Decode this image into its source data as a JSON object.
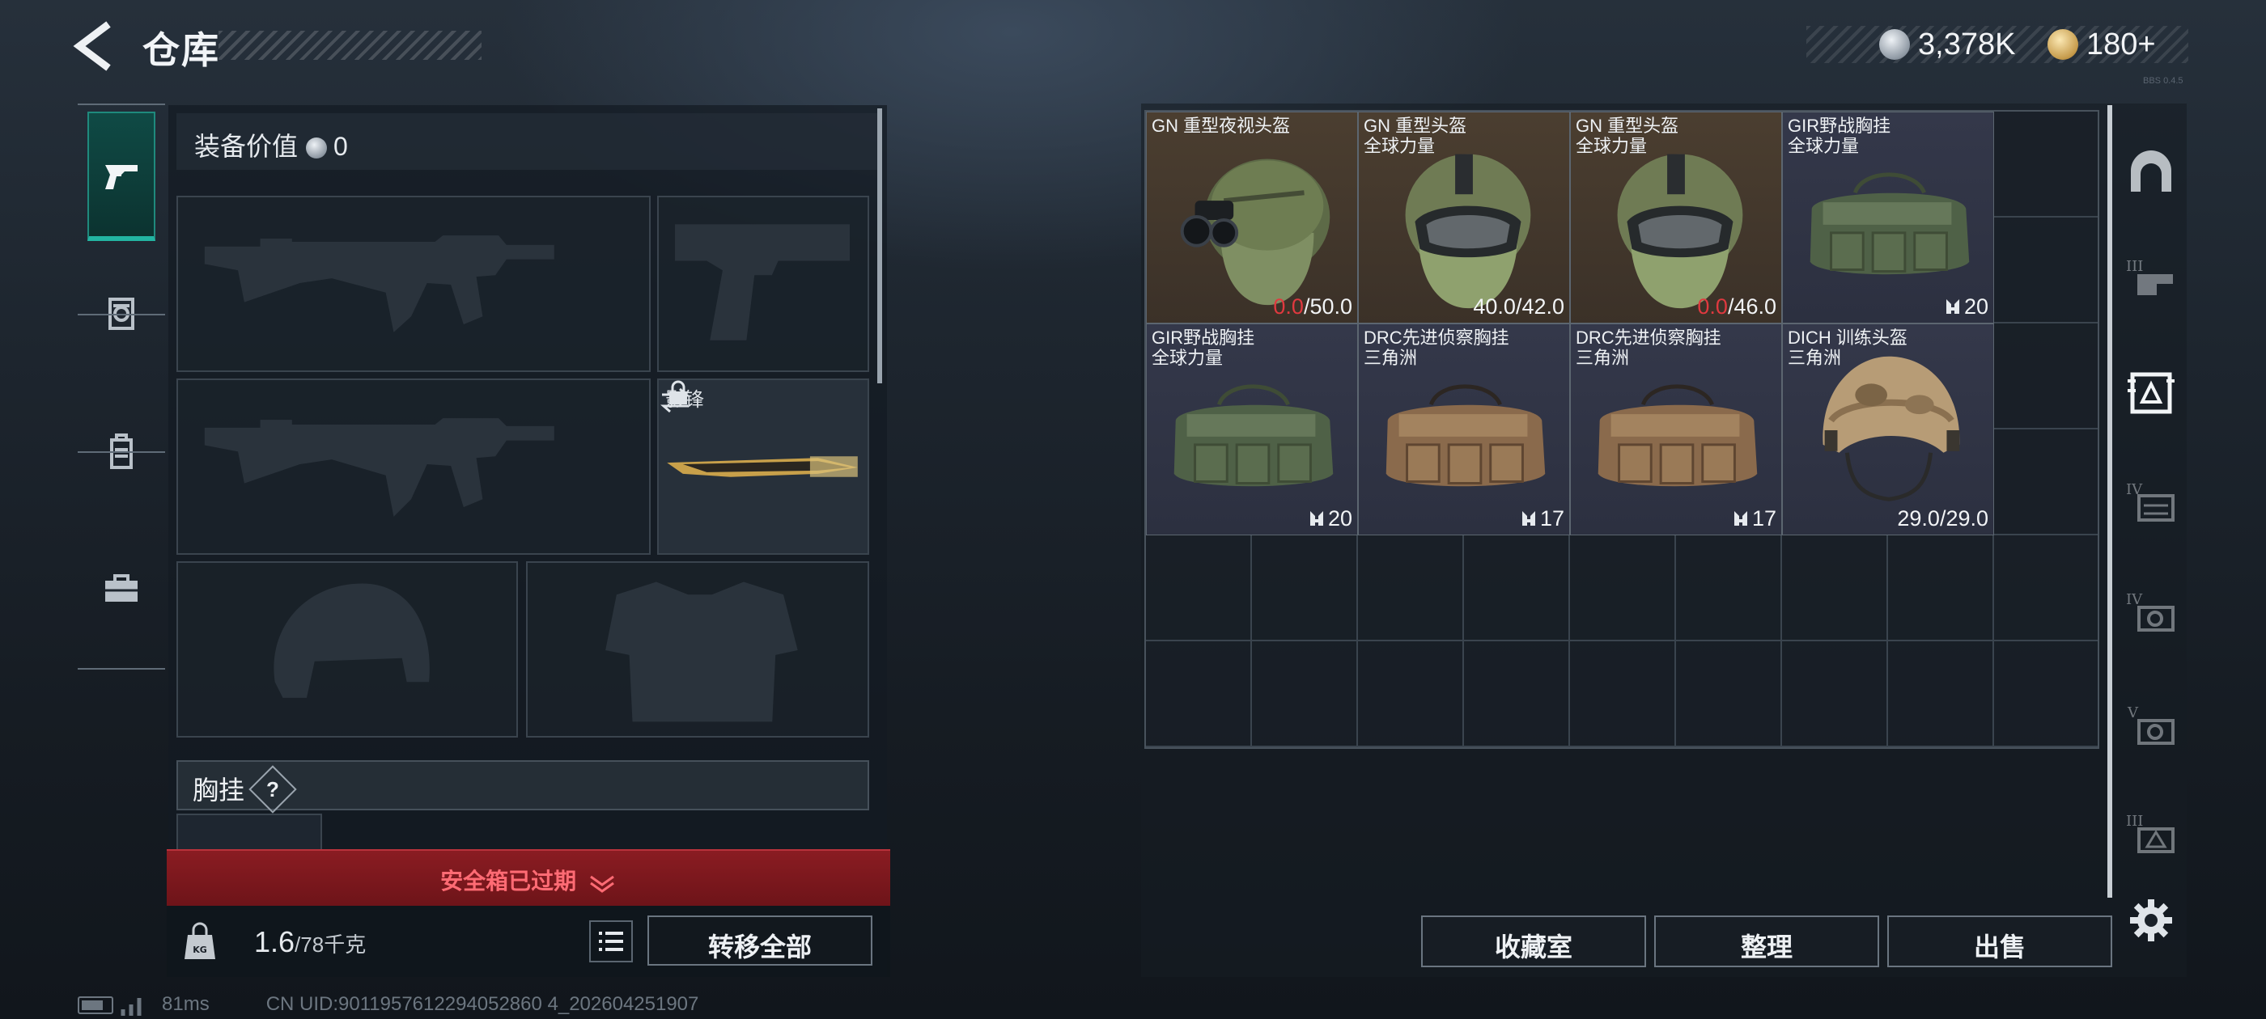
{
  "header": {
    "title": "仓库",
    "currency_silver": "3,378K",
    "currency_gold": "180+",
    "version": "BBS 0.4.5"
  },
  "left_nav": {
    "items": [
      {
        "name": "weapons",
        "icon": "pistol-icon",
        "active": true
      },
      {
        "name": "armor-rig",
        "icon": "rig-icon",
        "active": false
      },
      {
        "name": "backpack",
        "icon": "backpack-icon",
        "active": false
      },
      {
        "name": "briefcase",
        "icon": "briefcase-icon",
        "active": false
      }
    ]
  },
  "loadout": {
    "equip_value_label": "装备价值",
    "equip_value": "0",
    "melee_name": "影锋",
    "chest_rig_label": "胸挂",
    "chest_rig_help": "?",
    "safe_box_banner": "安全箱已过期",
    "weight_current": "1.6",
    "weight_max": "/78千克",
    "transfer_all_label": "转移全部"
  },
  "stash": {
    "items": [
      {
        "name": "GN 重型夜视头盔",
        "sub": "",
        "durability_current": "0.0",
        "durability_max": "/50.0",
        "current_red": true,
        "bg": "brown"
      },
      {
        "name": "GN 重型头盔",
        "sub": "全球力量",
        "durability_current": "40.0",
        "durability_max": "/42.0",
        "current_red": false,
        "bg": "brown"
      },
      {
        "name": "GN 重型头盔",
        "sub": "全球力量",
        "durability_current": "0.0",
        "durability_max": "/46.0",
        "current_red": true,
        "bg": "brown"
      },
      {
        "name": "GIR野战胸挂",
        "sub": "全球力量",
        "capacity": "20",
        "bg": "blue"
      },
      {
        "name": "GIR野战胸挂",
        "sub": "全球力量",
        "capacity": "20",
        "bg": "blue"
      },
      {
        "name": "DRC先进侦察胸挂",
        "sub": "三角洲",
        "capacity": "17",
        "bg": "blue"
      },
      {
        "name": "DRC先进侦察胸挂",
        "sub": "三角洲",
        "capacity": "17",
        "bg": "blue"
      },
      {
        "name": "DICH 训练头盔",
        "sub": "三角洲",
        "durability_current": "29.0",
        "durability_max": "/29.0",
        "current_red": false,
        "bg": "blue"
      }
    ],
    "buttons": {
      "collection": "收藏室",
      "sort": "整理",
      "sell": "出售"
    }
  },
  "status_bar": {
    "ping": "81ms",
    "uid": "CN UID:9011957612294052860 4_202604251907"
  },
  "colors": {
    "accent_teal": "#23b5a2",
    "danger_red": "#e0393f",
    "banner_red": "#8a1c22"
  }
}
